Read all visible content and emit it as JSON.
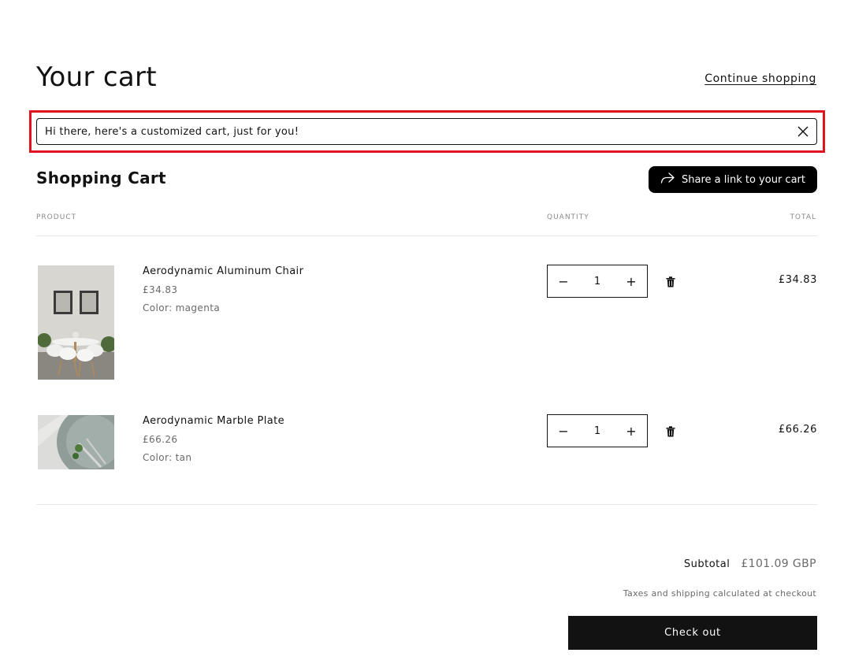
{
  "header": {
    "title": "Your cart",
    "continue_label": "Continue shopping"
  },
  "notice": {
    "text": "Hi there, here's a customized cart, just for you!",
    "close_icon": "close-icon",
    "highlight_color": "#e0141e"
  },
  "cart": {
    "heading": "Shopping Cart",
    "share_label": "Share a link to your cart",
    "share_icon": "share-arrow-icon",
    "columns": {
      "product": "PRODUCT",
      "quantity": "QUANTITY",
      "total": "TOTAL"
    },
    "items": [
      {
        "name": "Aerodynamic Aluminum Chair",
        "price": "£34.83",
        "color_label": "Color:",
        "color_value": "magenta",
        "quantity": "1",
        "total": "£34.83",
        "image_icon": "product-photo-chair"
      },
      {
        "name": "Aerodynamic Marble Plate",
        "price": "£66.26",
        "color_label": "Color:",
        "color_value": "tan",
        "quantity": "1",
        "total": "£66.26",
        "image_icon": "product-photo-plate"
      }
    ],
    "qty_minus": "−",
    "qty_plus": "+"
  },
  "summary": {
    "subtotal_label": "Subtotal",
    "subtotal_value": "£101.09 GBP",
    "tax_note": "Taxes and shipping calculated at checkout",
    "checkout_label": "Check out"
  },
  "colors": {
    "text": "#121212",
    "muted": "#6a6a6a",
    "button_bg": "#000000"
  }
}
